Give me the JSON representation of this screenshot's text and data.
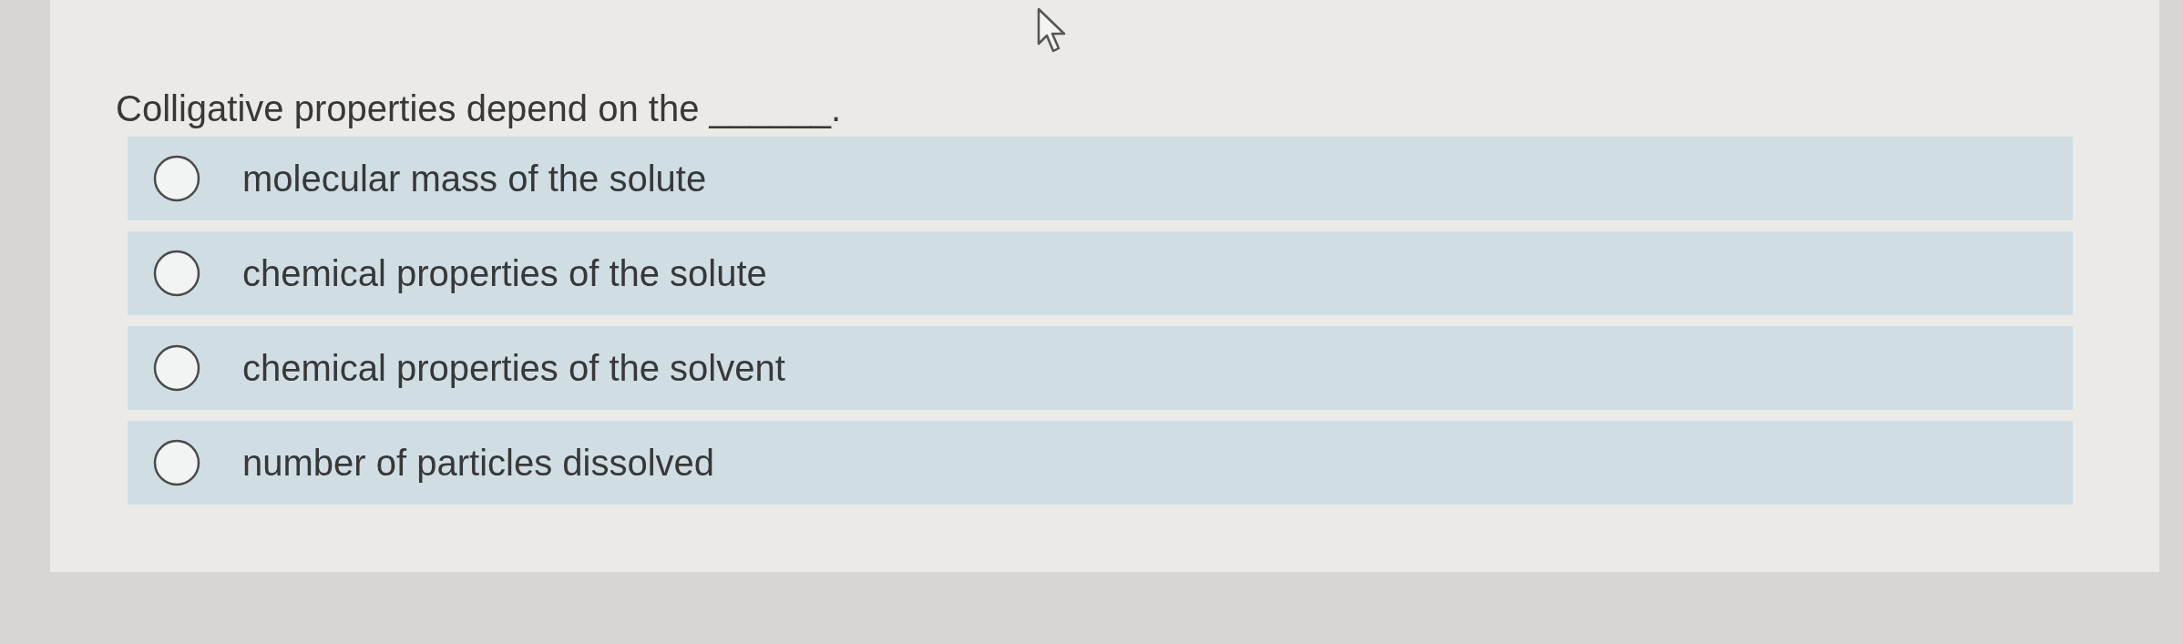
{
  "question": {
    "text": "Colligative properties depend on the ______."
  },
  "options": [
    {
      "label": "molecular mass of the solute",
      "selected": false
    },
    {
      "label": "chemical properties of the solute",
      "selected": false
    },
    {
      "label": "chemical properties of the solvent",
      "selected": false
    },
    {
      "label": "number of particles dissolved",
      "selected": false
    }
  ]
}
